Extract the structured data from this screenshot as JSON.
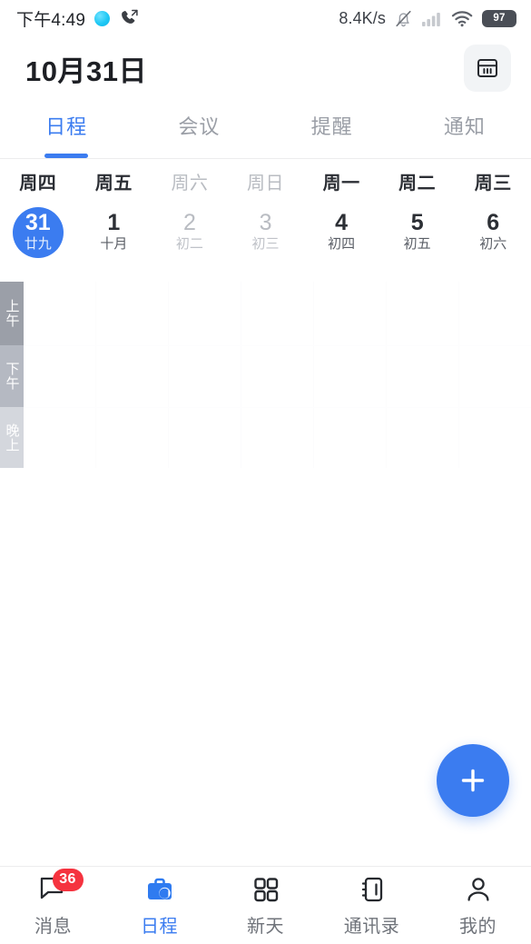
{
  "statusbar": {
    "time": "下午4:49",
    "dot_icon": "chat-dot-icon",
    "call_icon": "missed-call-icon",
    "network_speed": "8.4K/s",
    "mute_icon": "bell-muted-icon",
    "signal_icon": "signal-bars-icon",
    "wifi_icon": "wifi-icon",
    "battery_level": "97"
  },
  "header": {
    "title": "10月31日",
    "month_view_icon": "calendar-month-icon"
  },
  "tabs": [
    {
      "label": "日程",
      "active": true
    },
    {
      "label": "会议",
      "active": false
    },
    {
      "label": "提醒",
      "active": false
    },
    {
      "label": "通知",
      "active": false
    }
  ],
  "week": [
    {
      "dow": "周四",
      "num": "31",
      "lunar": "廿九",
      "selected": true,
      "weekend": false
    },
    {
      "dow": "周五",
      "num": "1",
      "lunar": "十月",
      "selected": false,
      "weekend": false
    },
    {
      "dow": "周六",
      "num": "2",
      "lunar": "初二",
      "selected": false,
      "weekend": true
    },
    {
      "dow": "周日",
      "num": "3",
      "lunar": "初三",
      "selected": false,
      "weekend": true
    },
    {
      "dow": "周一",
      "num": "4",
      "lunar": "初四",
      "selected": false,
      "weekend": false
    },
    {
      "dow": "周二",
      "num": "5",
      "lunar": "初五",
      "selected": false,
      "weekend": false
    },
    {
      "dow": "周三",
      "num": "6",
      "lunar": "初六",
      "selected": false,
      "weekend": false
    }
  ],
  "periods": [
    {
      "label": "上午"
    },
    {
      "label": "下午"
    },
    {
      "label": "晚上"
    }
  ],
  "fab": {
    "icon": "plus-icon"
  },
  "bottomnav": [
    {
      "label": "消息",
      "icon": "message-bubble-icon",
      "badge": "36",
      "active": false
    },
    {
      "label": "日程",
      "icon": "briefcase-icon",
      "badge": "",
      "active": true
    },
    {
      "label": "新天",
      "icon": "grid-apps-icon",
      "badge": "",
      "active": false
    },
    {
      "label": "通讯录",
      "icon": "contacts-book-icon",
      "badge": "",
      "active": false
    },
    {
      "label": "我的",
      "icon": "person-icon",
      "badge": "",
      "active": false
    }
  ],
  "colors": {
    "accent_blue": "#3b7cf0",
    "badge_red": "#f5333f",
    "text_dark": "#2c2f35",
    "text_muted": "#9a9ea6"
  }
}
